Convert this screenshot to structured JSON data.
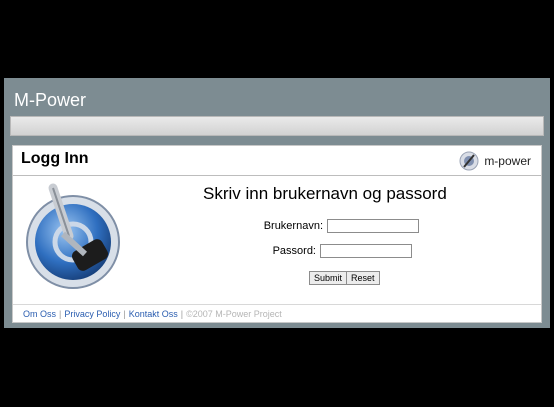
{
  "app": {
    "title": "M-Power"
  },
  "panel": {
    "title": "Logg Inn",
    "brand": "m-power"
  },
  "login": {
    "heading": "Skriv inn brukernavn og passord",
    "username_label": "Brukernavn:",
    "username_value": "",
    "password_label": "Passord:",
    "password_value": "",
    "submit_label": "Submit",
    "reset_label": "Reset"
  },
  "footer": {
    "links": [
      "Om Oss",
      "Privacy Policy",
      "Kontakt Oss"
    ],
    "separator": "|",
    "copyright": "©2007 M-Power Project"
  },
  "colors": {
    "app_bg": "#7d8c92",
    "link": "#2a5db0"
  }
}
